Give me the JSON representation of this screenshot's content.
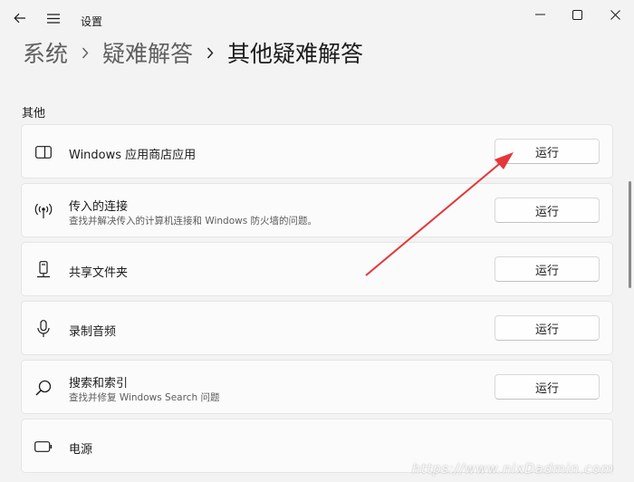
{
  "window": {
    "title": "设置"
  },
  "breadcrumb": {
    "items": [
      "系统",
      "疑难解答"
    ],
    "current": "其他疑难解答"
  },
  "section": {
    "label": "其他"
  },
  "troubleshooters": [
    {
      "title": "Windows 应用商店应用",
      "description": "",
      "button": "运行",
      "icon": "app-window-icon"
    },
    {
      "title": "传入的连接",
      "description": "查找并解决传入的计算机连接和 Windows 防火墙的问题。",
      "button": "运行",
      "icon": "broadcast-icon"
    },
    {
      "title": "共享文件夹",
      "description": "",
      "button": "运行",
      "icon": "shared-folder-server-icon"
    },
    {
      "title": "录制音频",
      "description": "",
      "button": "运行",
      "icon": "microphone-icon"
    },
    {
      "title": "搜索和索引",
      "description": "查找并修复 Windows Search 问题",
      "button": "运行",
      "icon": "search-icon"
    },
    {
      "title": "电源",
      "description": "",
      "button": "",
      "icon": "battery-icon"
    }
  ],
  "colors": {
    "annotation_arrow": "#e5363a",
    "background": "#f3f3f3",
    "card": "#fbfbfb"
  },
  "watermark": {
    "text": "https://www.nixDadmin.com"
  }
}
